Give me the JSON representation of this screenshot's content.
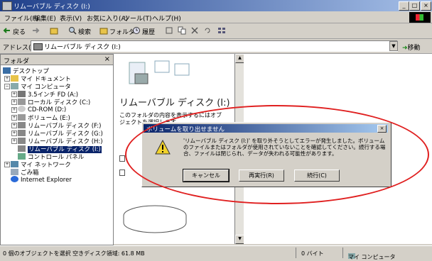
{
  "window": {
    "title": "リムーバブル ディスク (I:)",
    "controls": {
      "minimize": "_",
      "maximize": "□",
      "close": "×"
    }
  },
  "menu": [
    "ファイル(F)",
    "編集(E)",
    "表示(V)",
    "お気に入り(A)",
    "ツール(T)",
    "ヘルプ(H)"
  ],
  "toolbar": {
    "back": "戻る",
    "search": "検索",
    "folders": "フォルダ",
    "history": "履歴"
  },
  "address": {
    "label": "アドレス(D)",
    "value": "リムーバブル ディスク (I:)",
    "go": "移動"
  },
  "folders_pane": {
    "title": "フォルダ",
    "close": "×",
    "items": [
      {
        "label": "デスクトップ"
      },
      {
        "label": "マイ ドキュメント"
      },
      {
        "label": "マイ コンピュータ"
      },
      {
        "label": "3.5インチ FD (A:)"
      },
      {
        "label": "ローカル ディスク (C:)"
      },
      {
        "label": "CD-ROM (D:)"
      },
      {
        "label": "ボリューム (E:)"
      },
      {
        "label": "リムーバブル ディスク (F:)"
      },
      {
        "label": "リムーバブル ディスク (G:)"
      },
      {
        "label": "リムーバブル ディスク (H:)"
      },
      {
        "label": "リムーバブル ディスク (I:)"
      },
      {
        "label": "コントロール パネル"
      },
      {
        "label": "マイ ネットワーク"
      },
      {
        "label": "ごみ箱"
      },
      {
        "label": "Internet Explorer"
      }
    ]
  },
  "content": {
    "heading": "リムーバブル ディスク (I:)",
    "desc": "このフォルダの内容を表示するにはオブジェクトを選択します。"
  },
  "dialog": {
    "title": "ボリュームを取り出せません",
    "message": "'リムーバブル ディスク (I:)' を取り外そうとしてエラーが発生しました。ボリュームのファイルまたはフォルダが使用されていないことを確認してください。続行する場合、ファイルは閉じられ、データが失われる可能性があります。",
    "buttons": [
      "キャンセル",
      "再実行(R)",
      "続行(C)"
    ]
  },
  "status": {
    "left": "0 個のオブジェクトを選択  空きディスク領域: 61.8 MB",
    "size": "0 バイト",
    "zone": "マイ コンピュータ"
  }
}
